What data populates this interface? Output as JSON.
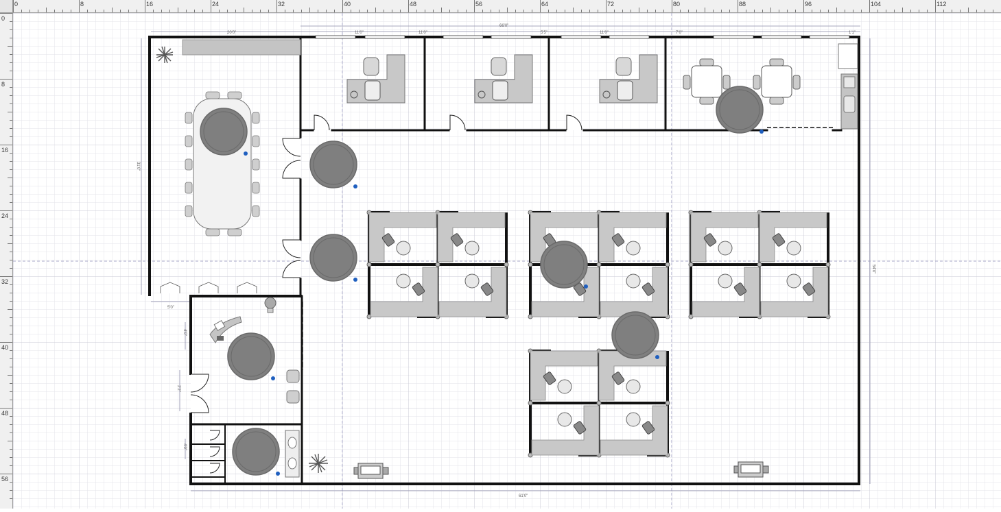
{
  "ruler": {
    "top_labels": [
      "0",
      "8",
      "16",
      "24",
      "32",
      "40",
      "48",
      "56",
      "64",
      "72",
      "80",
      "88",
      "96",
      "104",
      "112"
    ],
    "left_labels": [
      "0",
      "8",
      "16",
      "24",
      "32",
      "40",
      "48",
      "56"
    ]
  },
  "dimensions": {
    "overall_width": "66'0\"",
    "bottom_width": "61'0\"",
    "right_height": "54'0\"",
    "left_height": "31'0\"",
    "conference_width": "20'0\"",
    "office1_width": "11'0\"",
    "office2_width": "11'0\"",
    "office3_width": "5'5\"",
    "office4_width": "11'0\"",
    "breakroom_width": "7'0\"",
    "kitchen_width": "1'1\"",
    "reception_offset": "5'0\"",
    "reception_height": "4'0\"",
    "reception_door": "2'2\"",
    "restroom_height": "4'0\""
  },
  "colors": {
    "wall": "#111111",
    "furniture": "#c8c8c8",
    "furniture_dark": "#8c8c8c",
    "marker": "#7f7f7f",
    "grid_minor": "#e3e3ea",
    "grid_major": "#c9c9d4",
    "info": "#1f5fbf"
  },
  "icons": [
    "plant-icon",
    "desk-chair-icon",
    "info-icon",
    "printer-icon",
    "sink-icon",
    "toilet-icon"
  ]
}
